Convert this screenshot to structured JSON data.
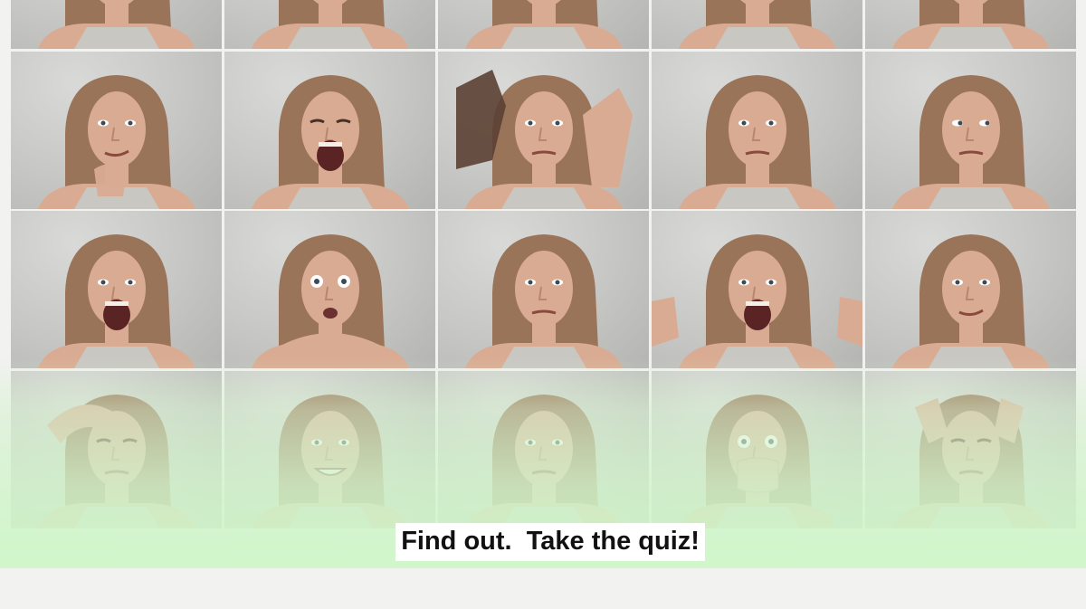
{
  "banner": {
    "caption": "Find out.  Take the quiz!"
  },
  "photo_grid": {
    "columns": 5,
    "rows": 4,
    "tiles": [
      {
        "expression": "neutral",
        "gesture": "none"
      },
      {
        "expression": "neutral",
        "gesture": "none"
      },
      {
        "expression": "neutral",
        "gesture": "none"
      },
      {
        "expression": "neutral",
        "gesture": "none"
      },
      {
        "expression": "neutral",
        "gesture": "none"
      },
      {
        "expression": "thinking",
        "gesture": "hand-chin"
      },
      {
        "expression": "screaming",
        "gesture": "none"
      },
      {
        "expression": "disgust",
        "gesture": "hands-up"
      },
      {
        "expression": "angry",
        "gesture": "none"
      },
      {
        "expression": "side-glance",
        "gesture": "none"
      },
      {
        "expression": "yelling",
        "gesture": "none"
      },
      {
        "expression": "shocked",
        "gesture": "arms-crossed"
      },
      {
        "expression": "frown",
        "gesture": "none"
      },
      {
        "expression": "rage",
        "gesture": "hands-out"
      },
      {
        "expression": "smirk",
        "gesture": "none"
      },
      {
        "expression": "headache",
        "gesture": "hand-forehead"
      },
      {
        "expression": "grin",
        "gesture": "none"
      },
      {
        "expression": "skeptical",
        "gesture": "none"
      },
      {
        "expression": "surprised",
        "gesture": "hand-mouth"
      },
      {
        "expression": "stressed",
        "gesture": "hands-head"
      }
    ]
  },
  "colors": {
    "overlay_green": "#cef6c8",
    "caption_bg": "#ffffff",
    "caption_text": "#111111",
    "hair": "#9a7458",
    "skin": "#d9ab92"
  }
}
